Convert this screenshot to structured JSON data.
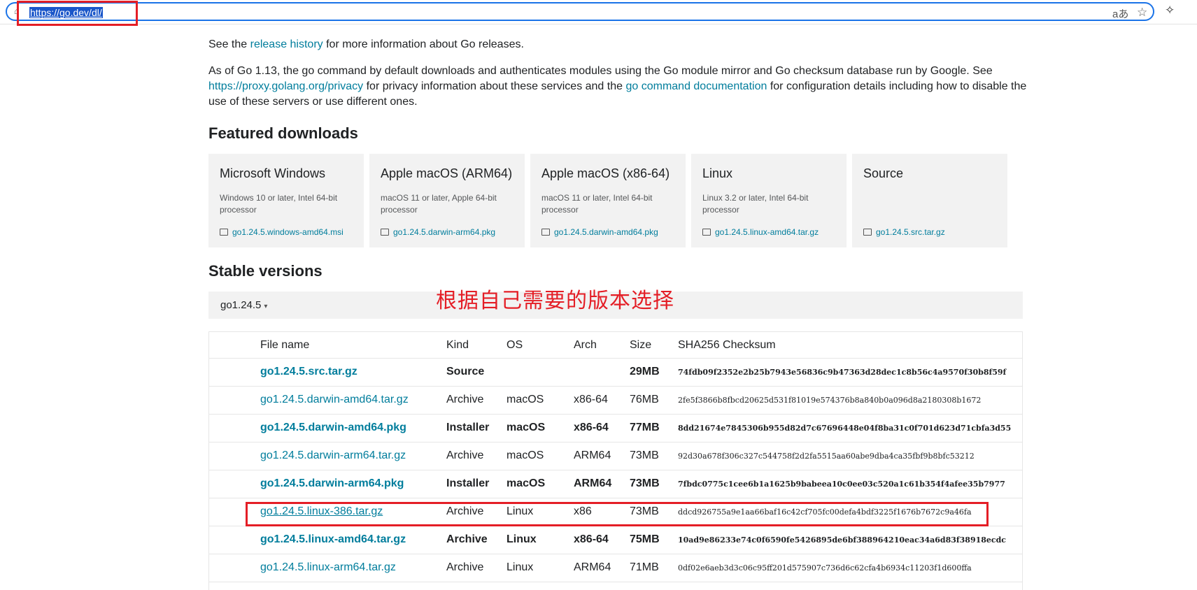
{
  "browser": {
    "url": "https://go.dev/dl/",
    "icons": [
      "info-icon",
      "read-aloud-icon",
      "favorite-star-icon",
      "extensions-icon"
    ]
  },
  "intro": {
    "line1_pre": "See the ",
    "line1_link": "release history",
    "line1_post": " for more information about Go releases.",
    "p2_a": "As of Go 1.13, the go command by default downloads and authenticates modules using the Go module mirror and Go checksum database run by Google. See ",
    "p2_link1": "https://proxy.golang.org/privacy",
    "p2_b": " for privacy information about these services and the ",
    "p2_link2": "go command documentation",
    "p2_c": " for configuration details including how to disable the use of these servers or use different ones."
  },
  "featured": {
    "heading": "Featured downloads",
    "cards": [
      {
        "title": "Microsoft Windows",
        "desc": "Windows 10 or later, Intel 64-bit processor",
        "file": "go1.24.5.windows-amd64.msi"
      },
      {
        "title": "Apple macOS (ARM64)",
        "desc": "macOS 11 or later, Apple 64-bit processor",
        "file": "go1.24.5.darwin-arm64.pkg"
      },
      {
        "title": "Apple macOS (x86-64)",
        "desc": "macOS 11 or later, Intel 64-bit processor",
        "file": "go1.24.5.darwin-amd64.pkg"
      },
      {
        "title": "Linux",
        "desc": "Linux 3.2 or later, Intel 64-bit processor",
        "file": "go1.24.5.linux-amd64.tar.gz"
      },
      {
        "title": "Source",
        "desc": "",
        "file": "go1.24.5.src.tar.gz"
      }
    ]
  },
  "stable": {
    "heading": "Stable versions",
    "version": "go1.24.5",
    "annotation": "根据自己需要的版本选择"
  },
  "table": {
    "headers": {
      "file": "File name",
      "kind": "Kind",
      "os": "OS",
      "arch": "Arch",
      "size": "Size",
      "sum": "SHA256 Checksum"
    },
    "rows": [
      {
        "file": "go1.24.5.src.tar.gz",
        "kind": "Source",
        "os": "",
        "arch": "",
        "size": "29MB",
        "sum": "74fdb09f2352e2b25b7943e56836c9b47363d28dec1c8b56c4a9570f30b8f59f",
        "featured": true
      },
      {
        "file": "go1.24.5.darwin-amd64.tar.gz",
        "kind": "Archive",
        "os": "macOS",
        "arch": "x86-64",
        "size": "76MB",
        "sum": "2fe5f3866b8fbcd20625d531f81019e574376b8a840b0a096d8a2180308b1672",
        "featured": false
      },
      {
        "file": "go1.24.5.darwin-amd64.pkg",
        "kind": "Installer",
        "os": "macOS",
        "arch": "x86-64",
        "size": "77MB",
        "sum": "8dd21674e7845306b955d82d7c67696448e04f8ba31c0f701d623d71cbfa3d55",
        "featured": true
      },
      {
        "file": "go1.24.5.darwin-arm64.tar.gz",
        "kind": "Archive",
        "os": "macOS",
        "arch": "ARM64",
        "size": "73MB",
        "sum": "92d30a678f306c327c544758f2d2fa5515aa60abe9dba4ca35fbf9b8bfc53212",
        "featured": false
      },
      {
        "file": "go1.24.5.darwin-arm64.pkg",
        "kind": "Installer",
        "os": "macOS",
        "arch": "ARM64",
        "size": "73MB",
        "sum": "7fbdc0775c1cee6b1a1625b9babeea10c0ee03c520a1c61b354f4afee35b7977",
        "featured": true
      },
      {
        "file": "go1.24.5.linux-386.tar.gz",
        "kind": "Archive",
        "os": "Linux",
        "arch": "x86",
        "size": "73MB",
        "sum": "ddcd926755a9e1aa66baf16c42cf705fc00defa4bdf3225f1676b7672c9a46fa",
        "featured": false
      },
      {
        "file": "go1.24.5.linux-amd64.tar.gz",
        "kind": "Archive",
        "os": "Linux",
        "arch": "x86-64",
        "size": "75MB",
        "sum": "10ad9e86233e74c0f6590fe5426895de6bf388964210eac34a6d83f38918ecdc",
        "featured": true
      },
      {
        "file": "go1.24.5.linux-arm64.tar.gz",
        "kind": "Archive",
        "os": "Linux",
        "arch": "ARM64",
        "size": "71MB",
        "sum": "0df02e6aeb3d3c06c95ff201d575907c736d6c62cfa4b6934c11203f1d600ffa",
        "featured": false
      }
    ]
  }
}
